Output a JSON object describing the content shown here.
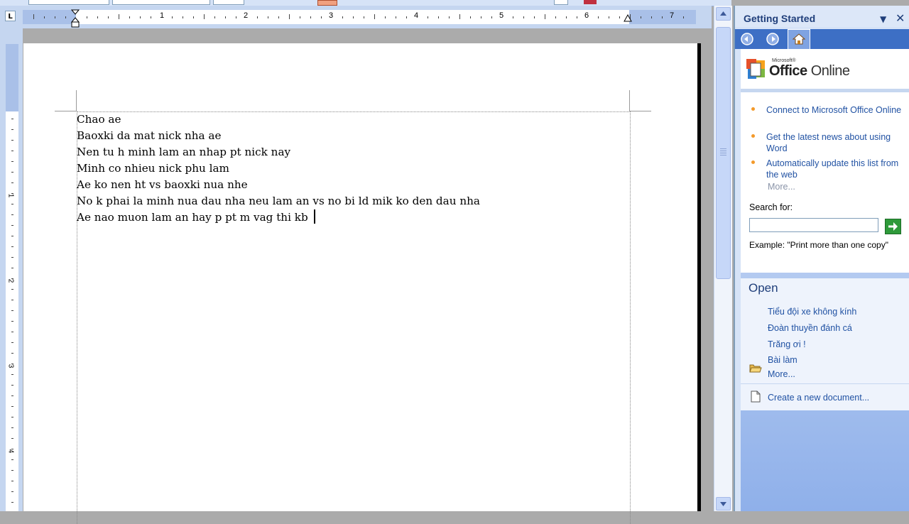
{
  "ruler": {
    "tab_selector": "L",
    "h_numbers": [
      "1",
      "2",
      "3",
      "4",
      "5",
      "6",
      "7"
    ],
    "v_numbers": [
      "1",
      "2",
      "3",
      "4"
    ]
  },
  "document": {
    "lines": [
      "Chao ae",
      "Baoxki da mat nick nha ae",
      "Nen tu h minh lam an nhap pt nick nay",
      "Minh co nhieu nick phu lam",
      "Ae ko nen ht vs baoxki nua nhe",
      "No k phai la minh nua dau nha neu lam an vs no bi ld mik ko den dau nha",
      "Ae nao muon lam an hay p pt m vag thi kb "
    ]
  },
  "task_pane": {
    "title": "Getting Started",
    "dropdown_icon": "▼",
    "close_icon": "✕",
    "nav": {
      "back_icon": "back-arrow",
      "forward_icon": "forward-arrow",
      "home_icon": "home"
    },
    "office_online": {
      "ms_label": "Microsoft®",
      "brand_office": "Office",
      "brand_online": " Online",
      "links": [
        "Connect to Microsoft Office Online",
        "Get the latest news about using Word",
        "Automatically update this list from the web"
      ],
      "more": "More...",
      "search_label": "Search for:",
      "search_value": "",
      "example_label": "Example:",
      "example_text": "\"Print more than one copy\""
    },
    "open": {
      "title": "Open",
      "files": [
        "Tiểu đội xe không kính",
        "Đoàn thuyền đánh cá",
        "Trăng ơi !",
        "Bài làm"
      ],
      "more": "More...",
      "create": "Create a new document..."
    }
  },
  "colors": {
    "accent_blue": "#2152A3",
    "pane_header": "#1F3E7A",
    "nav_bar": "#3D6FC5",
    "bullet_orange": "#F39A2B",
    "go_green": "#2E9A3A"
  }
}
